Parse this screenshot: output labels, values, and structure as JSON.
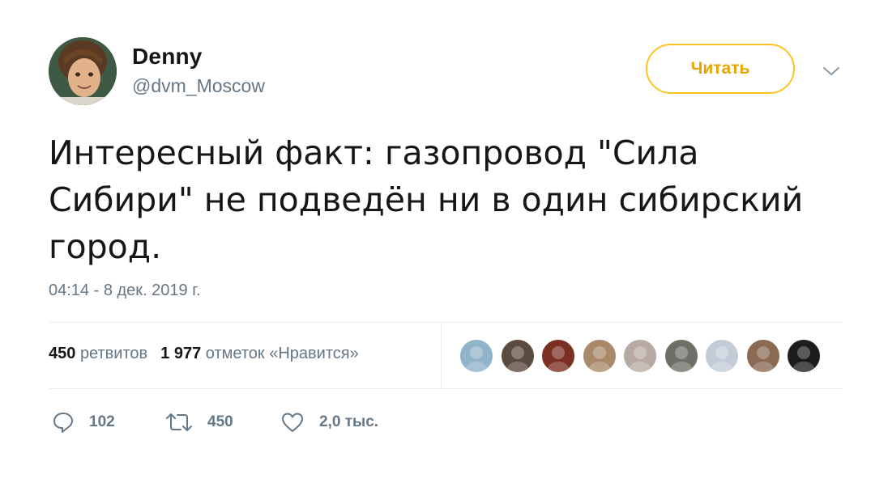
{
  "author": {
    "name": "Denny",
    "handle": "@dvm_Moscow"
  },
  "follow_button": {
    "label": "Читать"
  },
  "tweet": {
    "text": "Интересный факт: газопровод \"Сила Сибири\" не подведён ни в один сибирский город.",
    "timestamp": "04:14 - 8 дек. 2019 г."
  },
  "stats": {
    "retweets_count": "450",
    "retweets_label": "ретвитов",
    "likes_count": "1 977",
    "likes_label": "отметок «Нравится»"
  },
  "liker_avatars": [
    {
      "color": "#8fb3c9"
    },
    {
      "color": "#5b4a3f"
    },
    {
      "color": "#7a2f22"
    },
    {
      "color": "#a8896a"
    },
    {
      "color": "#b7a9a4"
    },
    {
      "color": "#6e7068"
    },
    {
      "color": "#c3ccd6"
    },
    {
      "color": "#8a6a52"
    },
    {
      "color": "#1d1d1d"
    }
  ],
  "actions": {
    "replies": "102",
    "retweets": "450",
    "likes": "2,0 тыс."
  },
  "colors": {
    "follow_border": "#ffc220",
    "follow_text": "#e9a400",
    "secondary_text": "#657786",
    "divider": "#e6ecf0"
  }
}
